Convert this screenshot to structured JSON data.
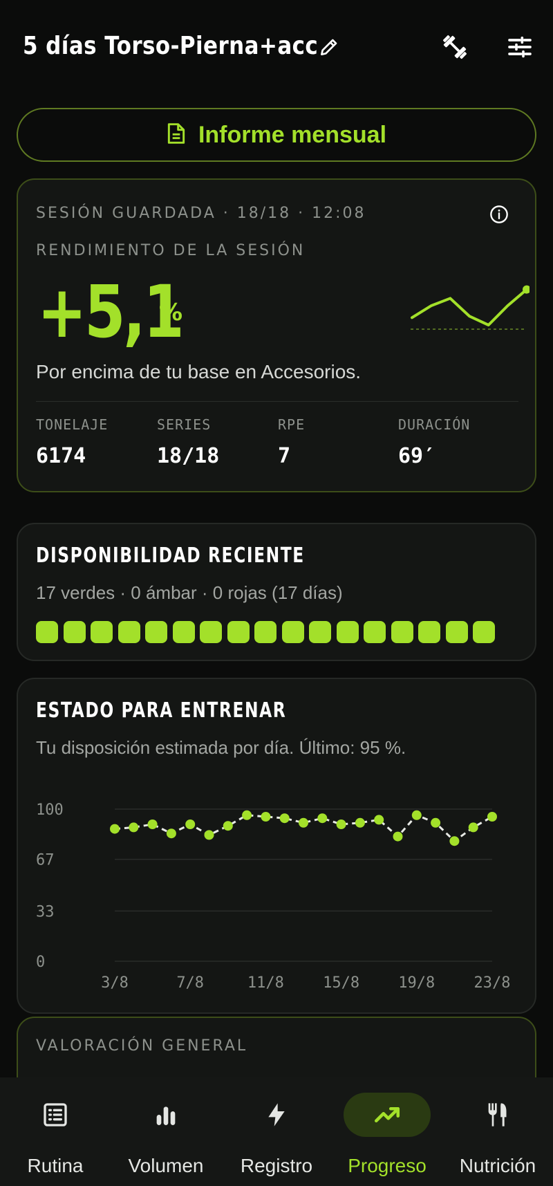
{
  "header": {
    "title": "5 días Torso-Pierna+acc",
    "icons": [
      "pencil-icon",
      "dumbbell-icon",
      "sliders-icon"
    ]
  },
  "report_button": {
    "label": "Informe mensual",
    "icon": "document-icon"
  },
  "session_card": {
    "kicker": "SESIÓN GUARDADA · 18/18 · 12:08",
    "section_label": "RENDIMIENTO DE LA SESIÓN",
    "value": "+5,1",
    "unit": "%",
    "description": "Por encima de tu base en Accesorios.",
    "sparkline": [
      62,
      70,
      75,
      63,
      57,
      70,
      81
    ],
    "stats": [
      {
        "label": "TONELAJE",
        "value": "6174"
      },
      {
        "label": "SERIES",
        "value": "18/18"
      },
      {
        "label": "RPE",
        "value": "7"
      },
      {
        "label": "DURACIÓN",
        "value": "69′"
      }
    ],
    "accent_color": "#a3e02a"
  },
  "availability_card": {
    "title": "DISPONIBILIDAD RECIENTE",
    "summary": "17 verdes · 0 ámbar · 0 rojas (17 días)",
    "days": [
      "green",
      "green",
      "green",
      "green",
      "green",
      "green",
      "green",
      "green",
      "green",
      "green",
      "green",
      "green",
      "green",
      "green",
      "green",
      "green",
      "green"
    ]
  },
  "readiness_card": {
    "title": "ESTADO PARA ENTRENAR",
    "subtitle": "Tu disposición estimada por día. Último: 95 %.",
    "chart_data": {
      "type": "line",
      "x": [
        "3/8",
        "4/8",
        "5/8",
        "6/8",
        "7/8",
        "8/8",
        "9/8",
        "10/8",
        "11/8",
        "12/8",
        "13/8",
        "14/8",
        "15/8",
        "16/8",
        "17/8",
        "18/8",
        "19/8",
        "20/8",
        "21/8",
        "22/8",
        "23/8"
      ],
      "values": [
        87,
        88,
        90,
        84,
        90,
        83,
        89,
        96,
        95,
        94,
        91,
        94,
        90,
        91,
        93,
        82,
        96,
        91,
        79,
        88,
        95
      ],
      "xticks": [
        "3/8",
        "7/8",
        "11/8",
        "15/8",
        "19/8",
        "23/8"
      ],
      "yticks": [
        "0",
        "33",
        "67",
        "100"
      ],
      "ylim": [
        0,
        100
      ],
      "grid": true
    }
  },
  "overall_card": {
    "kicker": "VALORACIÓN GENERAL"
  },
  "tabbar": {
    "tabs": [
      {
        "label": "Rutina",
        "icon": "list-icon",
        "active": false
      },
      {
        "label": "Volumen",
        "icon": "bar-chart-icon",
        "active": false
      },
      {
        "label": "Registro",
        "icon": "bolt-icon",
        "active": false
      },
      {
        "label": "Progreso",
        "icon": "trend-up-icon",
        "active": true
      },
      {
        "label": "Nutrición",
        "icon": "utensils-icon",
        "active": false
      }
    ]
  }
}
